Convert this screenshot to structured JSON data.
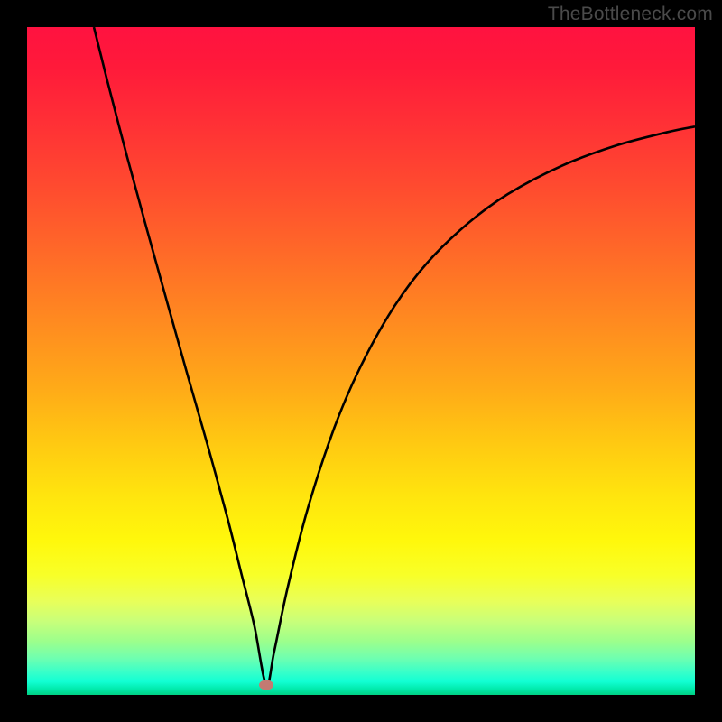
{
  "watermark": "TheBottleneck.com",
  "colors": {
    "frame_bg": "#000000",
    "curve_stroke": "#000000",
    "dot_fill": "#c47a72",
    "watermark_text": "#4a4a4a"
  },
  "chart_data": {
    "type": "line",
    "title": "",
    "xlabel": "",
    "ylabel": "",
    "xlim": [
      0,
      100
    ],
    "ylim": [
      0,
      100
    ],
    "annotations": [
      {
        "name": "optimal-point",
        "x": 35.8,
        "y": 1.5
      }
    ],
    "series": [
      {
        "name": "bottleneck-curve",
        "x": [
          10,
          12,
          15,
          18,
          21,
          24,
          27,
          30,
          32,
          34,
          35.8,
          37,
          39,
          42,
          46,
          50,
          55,
          60,
          66,
          72,
          80,
          88,
          96,
          100
        ],
        "y": [
          100,
          92,
          80.5,
          69.5,
          58.7,
          48,
          37.5,
          26.5,
          18.5,
          10.5,
          1.5,
          6.5,
          16,
          27.8,
          40,
          49.3,
          58.2,
          64.8,
          70.6,
          75,
          79.2,
          82.2,
          84.3,
          85.1
        ]
      }
    ],
    "background_gradient_stops": [
      {
        "pos": 0,
        "color": "#ff1240"
      },
      {
        "pos": 0.5,
        "color": "#ffaa18"
      },
      {
        "pos": 0.78,
        "color": "#fff80c"
      },
      {
        "pos": 0.92,
        "color": "#9cff8c"
      },
      {
        "pos": 1.0,
        "color": "#00d084"
      }
    ]
  }
}
